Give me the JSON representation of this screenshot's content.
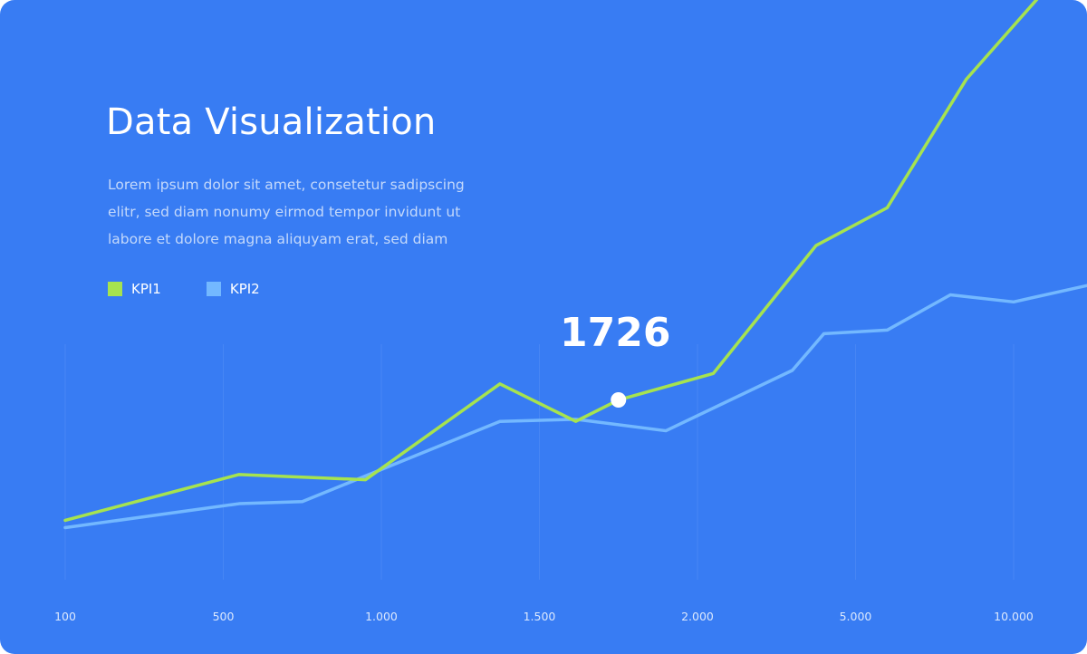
{
  "header": {
    "title": "Data Visualization",
    "description_lines": [
      "Lorem ipsum dolor sit amet, consetetur sadipscing",
      "elitr, sed diam nonumy eirmod tempor invidunt ut",
      "labore et dolore magna aliquyam erat, sed diam"
    ]
  },
  "colors": {
    "background": "#387cf3",
    "kpi1": "#a6e34f",
    "kpi2": "#73b8ff"
  },
  "chart_data": {
    "type": "line",
    "title": "Data Visualization",
    "x_tick_labels": [
      "100",
      "500",
      "1.000",
      "1.500",
      "2.000",
      "5.000",
      "10.000"
    ],
    "grid": "vertical",
    "legend_placement": "top-left",
    "series": [
      {
        "name": "KPI1",
        "x": [
          0,
          1.1,
          1.9,
          2.75,
          3.23,
          3.5,
          4.1,
          4.75,
          5.2,
          5.7,
          6.15
        ],
        "values": [
          570,
          1010,
          960,
          1880,
          1520,
          1726,
          1980,
          4500,
          5250,
          7800,
          9400
        ]
      },
      {
        "name": "KPI2",
        "x": [
          0,
          1.1,
          1.5,
          2.75,
          3.23,
          3.8,
          4.6,
          4.8,
          5.2,
          5.6,
          6.0,
          6.6
        ],
        "values": [
          500,
          730,
          750,
          1520,
          1540,
          1430,
          2020,
          2750,
          2820,
          3520,
          3380,
          3800
        ]
      }
    ],
    "annotation": {
      "label": "1726",
      "series": "KPI1",
      "x": 3.5,
      "value": 1726
    }
  }
}
